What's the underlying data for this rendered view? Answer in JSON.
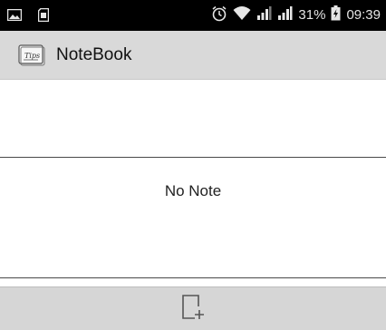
{
  "status_bar": {
    "battery_percent": "31%",
    "time": "09:39",
    "icons": [
      "image-icon",
      "sd-card-icon",
      "alarm-icon",
      "wifi-icon",
      "signal-icon",
      "signal-icon",
      "battery-charging-icon"
    ]
  },
  "action_bar": {
    "title": "NoteBook",
    "logo_text": "Tips"
  },
  "main": {
    "empty_message": "No Note"
  },
  "bottom_bar": {
    "add_icon": "new-note-icon"
  },
  "colors": {
    "status_bar_bg": "#000000",
    "action_bar_bg": "#d9d9d9",
    "bottom_bar_bg": "#d6d6d6"
  }
}
